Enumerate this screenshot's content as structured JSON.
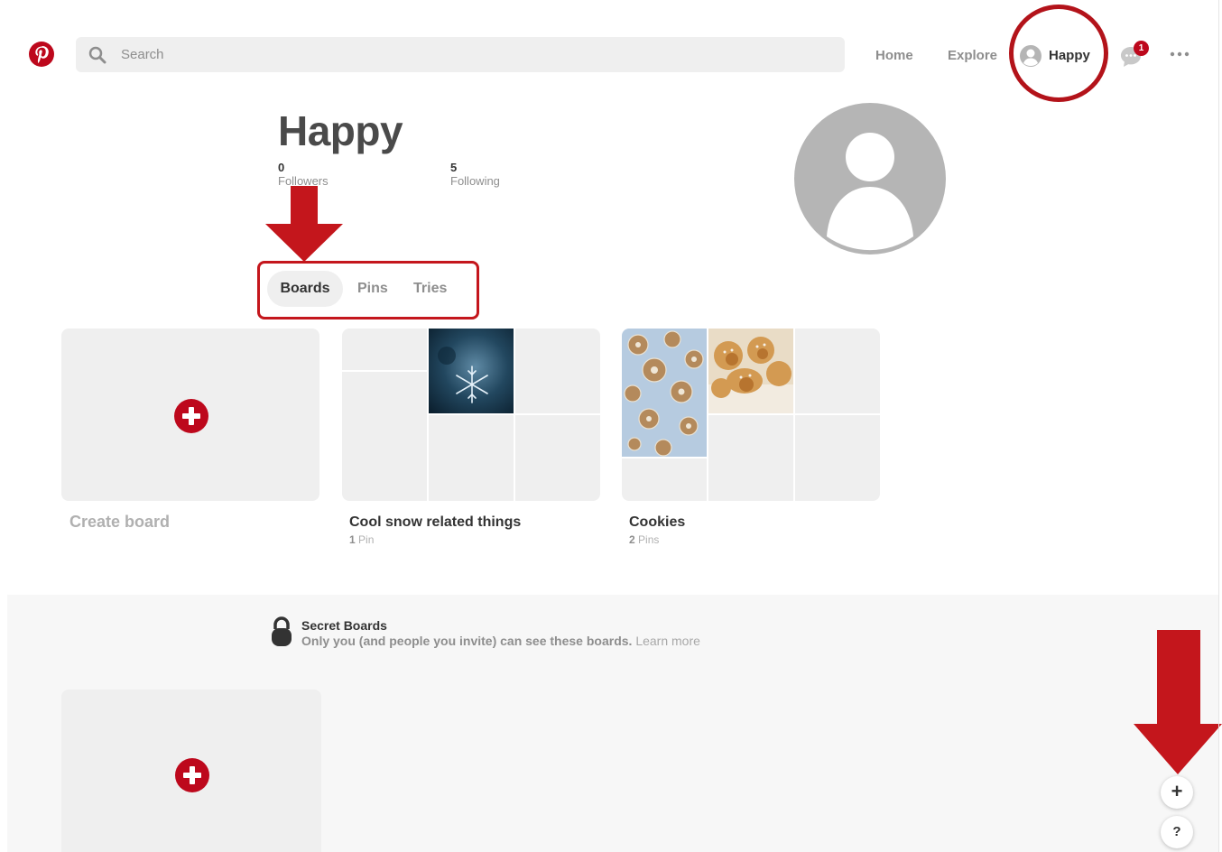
{
  "header": {
    "search_placeholder": "Search",
    "nav": {
      "home": "Home",
      "explore": "Explore",
      "profile": "Happy"
    },
    "messages_badge": "1"
  },
  "profile": {
    "name": "Happy",
    "followers_count": "0",
    "followers_label": "Followers",
    "following_count": "5",
    "following_label": "Following"
  },
  "tabs": [
    {
      "label": "Boards",
      "active": true
    },
    {
      "label": "Pins",
      "active": false
    },
    {
      "label": "Tries",
      "active": false
    }
  ],
  "boards": {
    "create_label": "Create board",
    "items": [
      {
        "title": "Cool snow related things",
        "count": "1",
        "count_label": "Pin"
      },
      {
        "title": "Cookies",
        "count": "2",
        "count_label": "Pins"
      }
    ]
  },
  "secret": {
    "title": "Secret Boards",
    "description": "Only you (and people you invite) can see these boards.",
    "learn_more": "Learn more"
  },
  "floating": {
    "add": "+",
    "help": "?"
  },
  "colors": {
    "brand": "#bd081c",
    "annotation": "#c4161c",
    "muted_text": "#8e8e8e",
    "tile": "#efefef"
  },
  "icons": [
    "pinterest-logo-icon",
    "search-icon",
    "user-avatar-icon",
    "chat-bubble-icon",
    "more-dots-icon",
    "plus-circle-icon",
    "lock-icon",
    "arrow-down-icon"
  ]
}
